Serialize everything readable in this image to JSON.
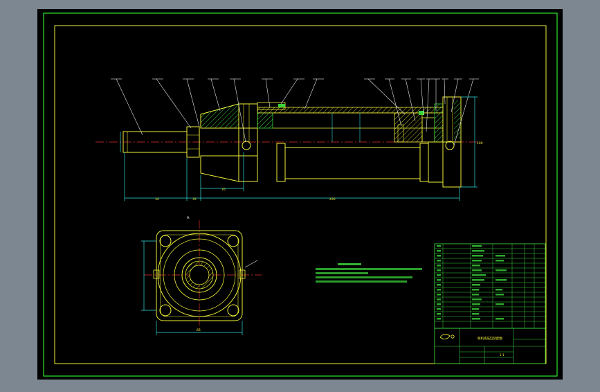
{
  "colors": {
    "viewport_bg": "#7d8791",
    "sheet_bg": "#000000",
    "outer_frame": "#2ee82e",
    "inner_frame": "#f2f23a",
    "part_lines": "#f2f23a",
    "dimension_lines": "#33e0e0",
    "center_lines": "#e23030",
    "hatch": "#3ad23a",
    "table_lines": "#3ad23a",
    "notes_text": "#3ad23a",
    "white_lines": "#e8e8e8"
  },
  "icons": {
    "company_logo": "logo-icon"
  },
  "dimensions": {
    "overall_length": "430",
    "left_part_length": "34",
    "shoulder": "35",
    "stroke_partial": "76",
    "end_height": "100",
    "front_width": "66"
  },
  "callouts": {
    "view_marker": "A"
  },
  "title_block": {
    "drawing_title": "联机液压缸装配图",
    "scale": "1:1"
  }
}
